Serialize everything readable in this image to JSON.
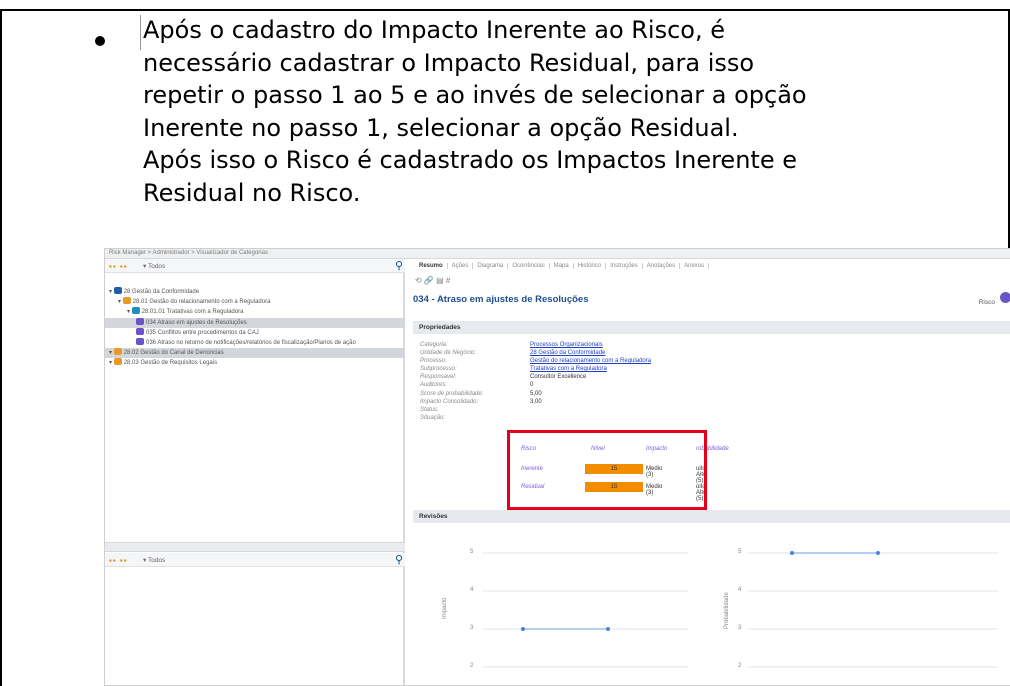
{
  "paragraph": {
    "lines": [
      "Após o cadastro do Impacto Inerente ao Risco, é",
      "necessário cadastrar o Impacto Residual, para isso",
      "repetir o passo 1 ao 5 e ao invés de selecionar a opção",
      "Inerente no passo 1, selecionar a opção Residual.",
      "Após isso o Risco é cadastrado os Impactos Inerente e",
      "Residual no Risco."
    ]
  },
  "screenshot": {
    "breadcrumb": "Risk Manager  >  Administrador  >  Visualizador de Categorias",
    "filter_top": {
      "dropdown": "Todos"
    },
    "filter_bottom": {
      "dropdown": "Todos"
    },
    "tree": [
      {
        "label": "28 Gestão da Conformidade",
        "indent": 0,
        "color": "#1f5fa8"
      },
      {
        "label": "28.01 Gestão do relacionamento com a Reguladora",
        "indent": 1,
        "color": "#e79b26"
      },
      {
        "label": "28.01.01 Tratativas com a Reguladora",
        "indent": 2,
        "color": "#1e8fc0"
      },
      {
        "label": "034 Atraso em ajustes de Resoluções",
        "indent": 3,
        "color": "#6b54c9",
        "selected": true
      },
      {
        "label": "035 Conflitos entre procedimentos da CAJ",
        "indent": 3,
        "color": "#6b54c9"
      },
      {
        "label": "036 Atraso no retorno de notificações/relatórios de fiscalização/Planos de ação",
        "indent": 3,
        "color": "#6b54c9"
      },
      {
        "label": "28.02 Gestão do Canal de Denúncias",
        "indent": 0,
        "color": "#e79b26",
        "selected": true
      },
      {
        "label": "28.03 Gestão de Requisitos Legais",
        "indent": 0,
        "color": "#e79b26"
      }
    ],
    "tabs": [
      "Resumo",
      "Ações",
      "Diagrama",
      "Ocorrências",
      "Mapa",
      "Histórico",
      "Instruções",
      "Anotações",
      "Anexos"
    ],
    "title": "034 - Atraso em ajustes de Resoluções",
    "title_right": "Risco",
    "section_properties": "Propriedades",
    "section_revisions": "Revisões",
    "properties": [
      {
        "label": "Categoria:",
        "value": "Processos Organizacionais",
        "link": true
      },
      {
        "label": "Unidade de Negócio:",
        "value": "28 Gestão da Conformidade",
        "link": true
      },
      {
        "label": "Processo:",
        "value": "Gestão do relacionamento com a Reguladora",
        "link": true
      },
      {
        "label": "Subprocesso:",
        "value": "Tratativas com a Reguladora",
        "link": true
      },
      {
        "label": "Responsável:",
        "value": "Consultor Excellence",
        "link": false
      },
      {
        "label": "Auditores:",
        "value": "0",
        "link": false
      },
      {
        "label": "Score de probabilidade:",
        "value": "5,00",
        "link": false
      },
      {
        "label": "Impacto Consolidado:",
        "value": "3,00",
        "link": false
      },
      {
        "label": "Status:",
        "value": "",
        "link": false
      },
      {
        "label": "Situação:",
        "value": "",
        "link": false
      }
    ],
    "risk_table": {
      "headers": [
        "Risco",
        "Nível",
        "Impacto",
        "robabilidade"
      ],
      "rows": [
        {
          "name": "Inerente",
          "level": "15",
          "impact": "Medio (3)",
          "probability": "uito Alto (5)"
        },
        {
          "name": "Residual",
          "level": "15",
          "impact": "Medio (3)",
          "probability": "uito Alto (5)"
        }
      ]
    },
    "charts": {
      "left": {
        "ylabel": "Impacto",
        "ticks": [
          "5",
          "4",
          "3",
          "2"
        ]
      },
      "right": {
        "ylabel": "Probabilidade",
        "ticks": [
          "5",
          "4",
          "3",
          "2"
        ]
      }
    }
  }
}
